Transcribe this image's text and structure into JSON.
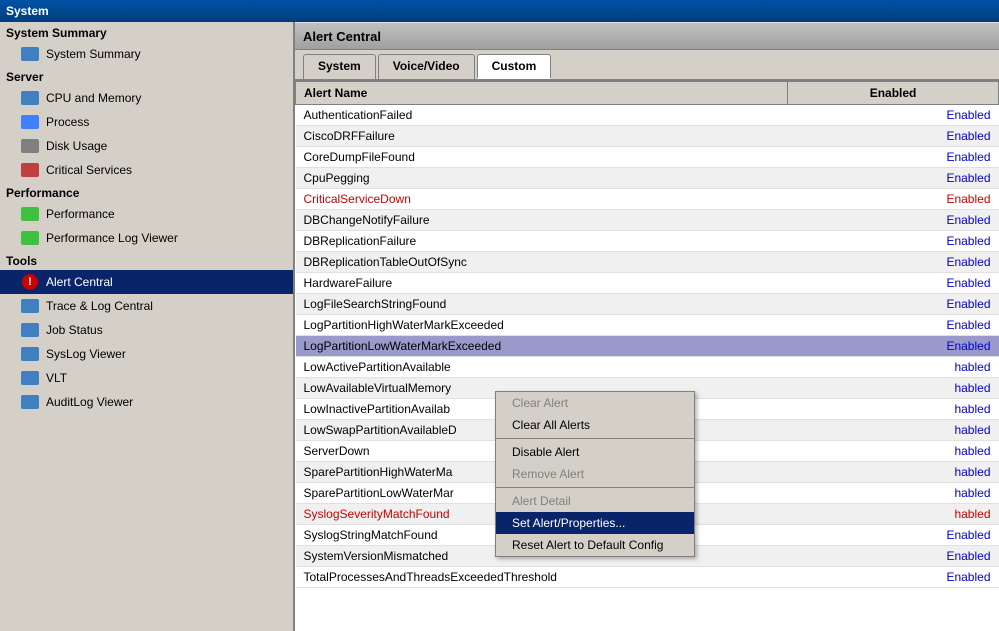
{
  "titleBar": {
    "label": "System"
  },
  "contentTitle": "Alert Central",
  "sidebar": {
    "sections": [
      {
        "label": "System Summary",
        "items": [
          {
            "id": "system-summary",
            "label": "System Summary",
            "icon": "summary",
            "active": false
          }
        ]
      },
      {
        "label": "Server",
        "items": [
          {
            "id": "cpu-memory",
            "label": "CPU and Memory",
            "icon": "monitor",
            "active": false
          },
          {
            "id": "process",
            "label": "Process",
            "icon": "tool",
            "active": false
          },
          {
            "id": "disk-usage",
            "label": "Disk Usage",
            "icon": "disk",
            "active": false
          },
          {
            "id": "critical-services",
            "label": "Critical Services",
            "icon": "crit",
            "active": false
          }
        ]
      },
      {
        "label": "Performance",
        "items": [
          {
            "id": "performance",
            "label": "Performance",
            "icon": "perf",
            "active": false
          },
          {
            "id": "performance-log",
            "label": "Performance Log Viewer",
            "icon": "log",
            "active": false
          }
        ]
      },
      {
        "label": "Tools",
        "items": [
          {
            "id": "alert-central",
            "label": "Alert Central",
            "icon": "alert",
            "active": true
          },
          {
            "id": "trace-log",
            "label": "Trace & Log Central",
            "icon": "trace",
            "active": false
          },
          {
            "id": "job-status",
            "label": "Job Status",
            "icon": "job",
            "active": false
          },
          {
            "id": "syslog-viewer",
            "label": "SysLog Viewer",
            "icon": "syslog",
            "active": false
          },
          {
            "id": "vlt",
            "label": "VLT",
            "icon": "vlt",
            "active": false
          },
          {
            "id": "auditlog-viewer",
            "label": "AuditLog Viewer",
            "icon": "audit",
            "active": false
          }
        ]
      }
    ]
  },
  "tabs": [
    {
      "id": "system",
      "label": "System",
      "active": false
    },
    {
      "id": "voice-video",
      "label": "Voice/Video",
      "active": false
    },
    {
      "id": "custom",
      "label": "Custom",
      "active": true
    }
  ],
  "table": {
    "headers": [
      "Alert Name",
      "Enabled"
    ],
    "rows": [
      {
        "name": "AuthenticationFailed",
        "enabled": "Enabled",
        "style": "enabled",
        "highlighted": false
      },
      {
        "name": "CiscoDRFFailure",
        "enabled": "Enabled",
        "style": "enabled",
        "highlighted": false
      },
      {
        "name": "CoreDumpFileFound",
        "enabled": "Enabled",
        "style": "enabled",
        "highlighted": false
      },
      {
        "name": "CpuPegging",
        "enabled": "Enabled",
        "style": "enabled",
        "highlighted": false
      },
      {
        "name": "CriticalServiceDown",
        "enabled": "Enabled",
        "style": "enabled-red",
        "highlighted": false
      },
      {
        "name": "DBChangeNotifyFailure",
        "enabled": "Enabled",
        "style": "enabled",
        "highlighted": false
      },
      {
        "name": "DBReplicationFailure",
        "enabled": "Enabled",
        "style": "enabled",
        "highlighted": false
      },
      {
        "name": "DBReplicationTableOutOfSync",
        "enabled": "Enabled",
        "style": "enabled",
        "highlighted": false
      },
      {
        "name": "HardwareFailure",
        "enabled": "Enabled",
        "style": "enabled",
        "highlighted": false
      },
      {
        "name": "LogFileSearchStringFound",
        "enabled": "Enabled",
        "style": "enabled",
        "highlighted": false
      },
      {
        "name": "LogPartitionHighWaterMarkExceeded",
        "enabled": "Enabled",
        "style": "enabled",
        "highlighted": false
      },
      {
        "name": "LogPartitionLowWaterMarkExceeded",
        "enabled": "Enabled",
        "style": "enabled",
        "highlighted": true
      },
      {
        "name": "LowActivePartitionAvailable",
        "enabled": "habled",
        "style": "partial",
        "highlighted": false
      },
      {
        "name": "LowAvailableVirtualMemory",
        "enabled": "habled",
        "style": "partial",
        "highlighted": false
      },
      {
        "name": "LowInactivePartitionAvailab",
        "enabled": "habled",
        "style": "partial",
        "highlighted": false
      },
      {
        "name": "LowSwapPartitionAvailableD",
        "enabled": "habled",
        "style": "partial",
        "highlighted": false
      },
      {
        "name": "ServerDown",
        "enabled": "habled",
        "style": "partial",
        "highlighted": false
      },
      {
        "name": "SparePartitionHighWaterMa",
        "enabled": "habled",
        "style": "partial",
        "highlighted": false
      },
      {
        "name": "SparePartitionLowWaterMar",
        "enabled": "habled",
        "style": "partial",
        "highlighted": false
      },
      {
        "name": "SyslogSeverityMatchFound",
        "enabled": "habled",
        "style": "enabled-red",
        "highlighted": false
      },
      {
        "name": "SyslogStringMatchFound",
        "enabled": "Enabled",
        "style": "enabled",
        "highlighted": false
      },
      {
        "name": "SystemVersionMismatched",
        "enabled": "Enabled",
        "style": "enabled",
        "highlighted": false
      },
      {
        "name": "TotalProcessesAndThreadsExceededThreshold",
        "enabled": "Enabled",
        "style": "enabled",
        "highlighted": false
      }
    ]
  },
  "contextMenu": {
    "items": [
      {
        "id": "clear-alert",
        "label": "Clear Alert",
        "disabled": true
      },
      {
        "id": "clear-all-alerts",
        "label": "Clear All Alerts",
        "disabled": false
      },
      {
        "id": "disable-alert",
        "label": "Disable Alert",
        "disabled": false
      },
      {
        "id": "remove-alert",
        "label": "Remove Alert",
        "disabled": true
      },
      {
        "id": "alert-detail",
        "label": "Alert Detail",
        "disabled": true
      },
      {
        "id": "set-alert-properties",
        "label": "Set Alert/Properties...",
        "disabled": false,
        "active": true
      },
      {
        "id": "reset-alert",
        "label": "Reset Alert to Default Config",
        "disabled": false
      }
    ]
  },
  "colors": {
    "enabled": "#0000cc",
    "enabledRed": "#cc0000",
    "highlighted": "#9999cc",
    "sidebarActive": "#0a246a",
    "activeText": "#ffffff"
  }
}
